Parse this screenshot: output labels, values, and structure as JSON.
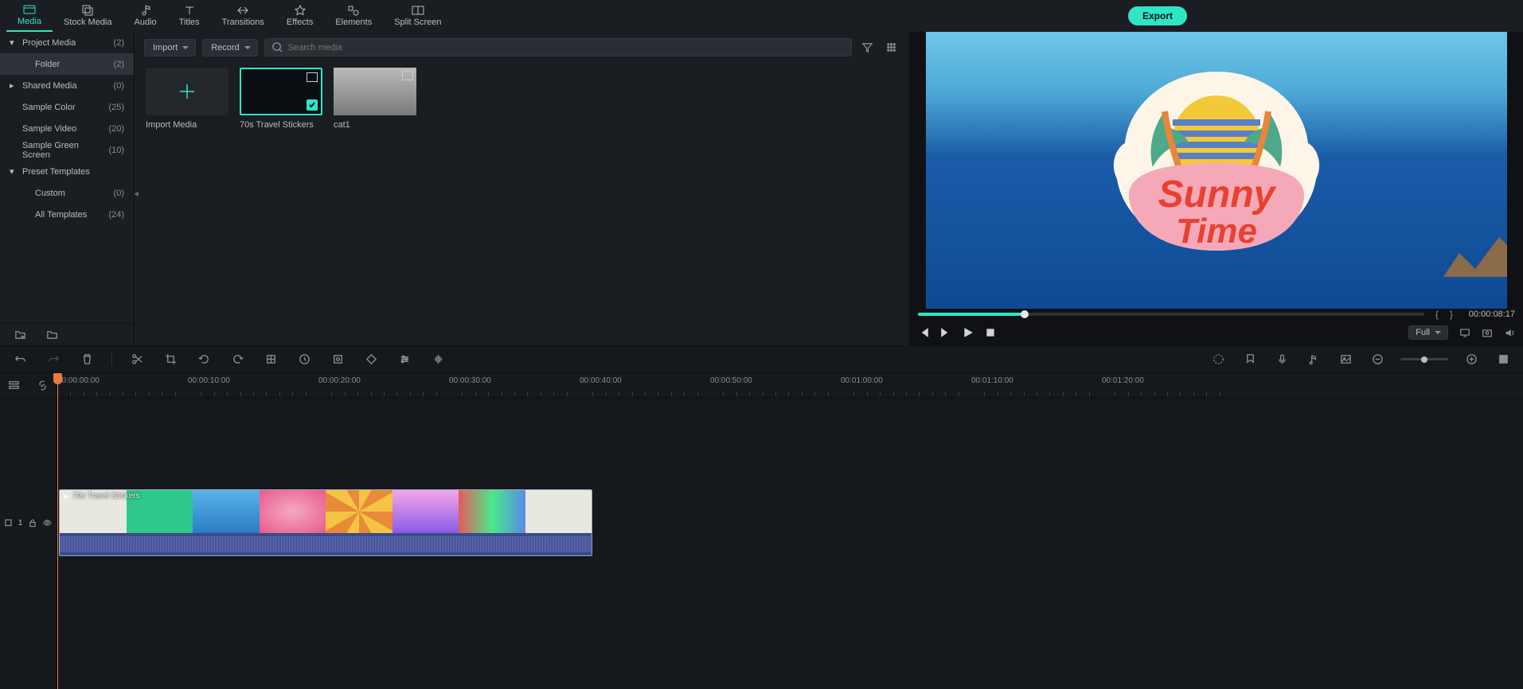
{
  "tabs": [
    {
      "label": "Media",
      "active": true
    },
    {
      "label": "Stock Media"
    },
    {
      "label": "Audio"
    },
    {
      "label": "Titles"
    },
    {
      "label": "Transitions"
    },
    {
      "label": "Effects"
    },
    {
      "label": "Elements"
    },
    {
      "label": "Split Screen"
    }
  ],
  "export_label": "Export",
  "sidebar": {
    "sections": [
      {
        "label": "Project Media",
        "count": "(2)",
        "caret": true,
        "children": [
          {
            "label": "Folder",
            "count": "(2)",
            "selected": true
          }
        ]
      },
      {
        "label": "Shared Media",
        "count": "(0)",
        "caret": true,
        "collapsed": true
      },
      {
        "label": "Sample Color",
        "count": "(25)"
      },
      {
        "label": "Sample Video",
        "count": "(20)"
      },
      {
        "label": "Sample Green Screen",
        "count": "(10)"
      },
      {
        "label": "Preset Templates",
        "count": "",
        "caret": true,
        "children": [
          {
            "label": "Custom",
            "count": "(0)"
          },
          {
            "label": "All Templates",
            "count": "(24)"
          }
        ]
      }
    ]
  },
  "media_toolbar": {
    "import_label": "Import",
    "record_label": "Record",
    "search_placeholder": "Search media"
  },
  "media_items": [
    {
      "label": "Import Media",
      "type": "import"
    },
    {
      "label": "70s Travel Stickers",
      "type": "video",
      "selected": true,
      "checked": true
    },
    {
      "label": "cat1",
      "type": "video"
    }
  ],
  "preview": {
    "timecode": "00:00:08:17",
    "quality": "Full",
    "progress_pct": 21
  },
  "timeline": {
    "ruler_ticks": [
      "00:00:00:00",
      "00:00:10:00",
      "00:00:20:00",
      "00:00:30:00",
      "00:00:40:00",
      "00:00:50:00",
      "00:01:00:00",
      "00:01:10:00",
      "00:01:20:00"
    ],
    "clip": {
      "label": "70s Travel Stickers"
    },
    "track_head": {
      "label": "1"
    }
  }
}
